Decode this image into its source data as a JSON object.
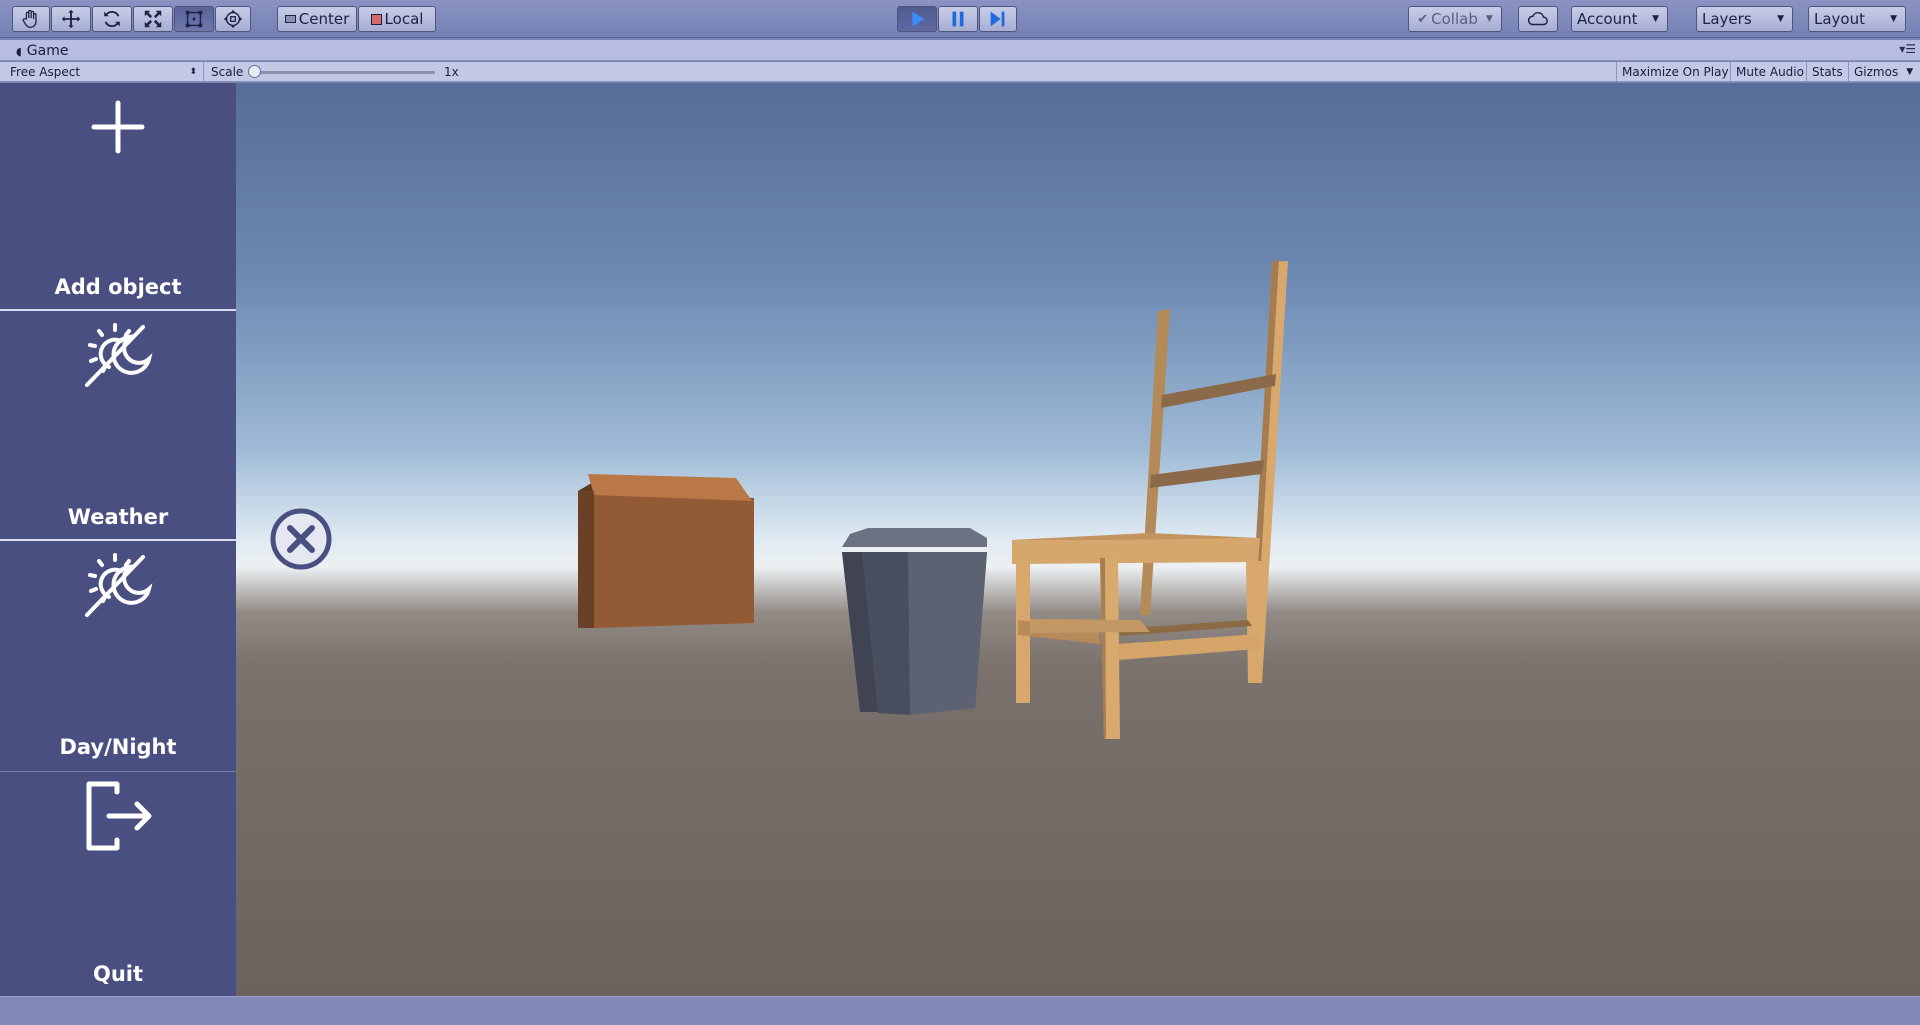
{
  "toolbar": {
    "tools": [
      "hand-icon",
      "move-icon",
      "rotate-icon",
      "scale-icon",
      "rect-transform-icon",
      "transform-all-icon"
    ],
    "pivot_label": "Center",
    "space_label": "Local",
    "play_icons": [
      "play-icon",
      "pause-icon",
      "step-icon"
    ],
    "collab_label": "Collab",
    "account_label": "Account",
    "layers_label": "Layers",
    "layout_label": "Layout"
  },
  "tab": {
    "title": "Game"
  },
  "gamebar": {
    "aspect": "Free Aspect",
    "scale_label": "Scale",
    "scale_value": "1x",
    "maximize": "Maximize On Play",
    "mute": "Mute Audio",
    "stats": "Stats",
    "gizmos": "Gizmos"
  },
  "sidebar": {
    "items": [
      {
        "label": "Add object",
        "icon": "plus-icon"
      },
      {
        "label": "Weather",
        "icon": "sun-moon-icon"
      },
      {
        "label": "Day/Night",
        "icon": "sun-moon-icon"
      },
      {
        "label": "Quit",
        "icon": "exit-icon"
      }
    ]
  },
  "colors": {
    "sidebar": "#4a4f82",
    "toolbar": "#7a84b3",
    "box": "#8f5834",
    "chair": "#d7a46a",
    "bin": "#4f5566"
  }
}
